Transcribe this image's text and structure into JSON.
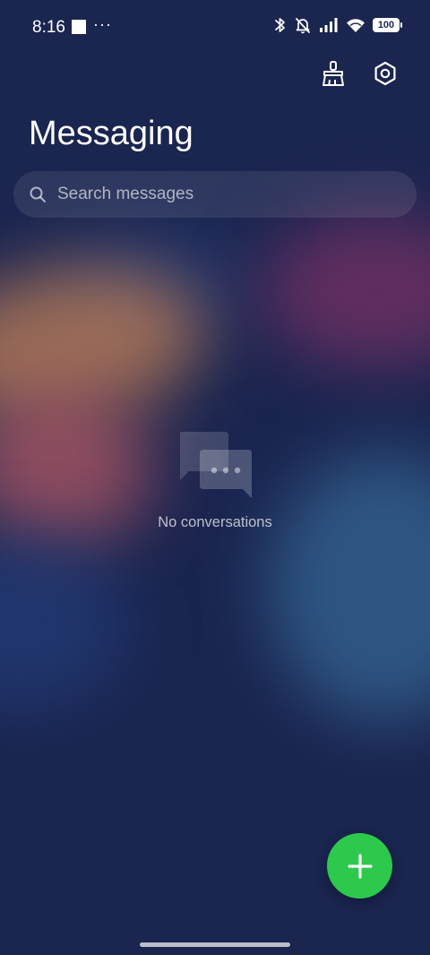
{
  "status_bar": {
    "time": "8:16",
    "more_indicator": "···",
    "battery_level": "100",
    "icons": [
      "bluetooth-icon",
      "silent-icon",
      "signal-icon",
      "wifi-icon",
      "battery-icon"
    ]
  },
  "header": {
    "title": "Messaging",
    "actions": [
      "clean-brush-icon",
      "settings-icon"
    ]
  },
  "search": {
    "placeholder": "Search messages"
  },
  "empty_state": {
    "icon": "conversations-icon",
    "text": "No conversations"
  },
  "fab": {
    "icon": "plus-icon",
    "color": "#2cc94c"
  },
  "colors": {
    "background": "#1a2550",
    "accent": "#2cc94c"
  }
}
